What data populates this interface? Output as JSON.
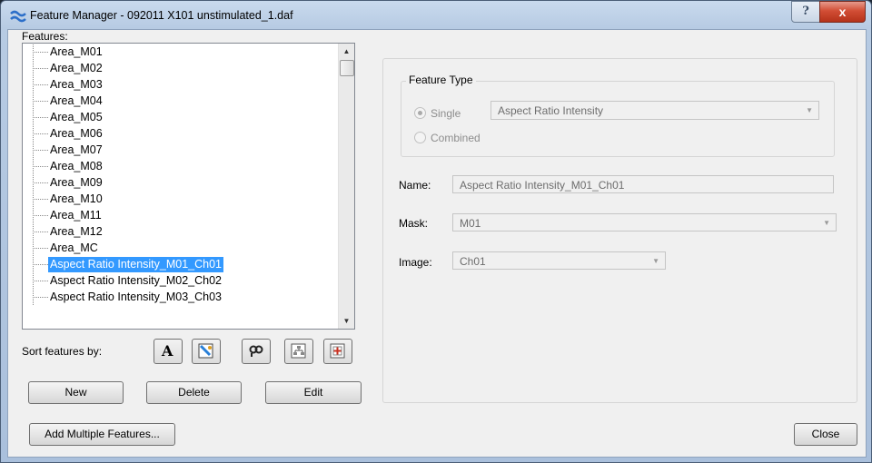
{
  "window": {
    "title": "Feature Manager - 092011 X101 unstimulated_1.daf",
    "help_label": "?",
    "close_label": "x"
  },
  "features_label": "Features:",
  "features": [
    "Area_M01",
    "Area_M02",
    "Area_M03",
    "Area_M04",
    "Area_M05",
    "Area_M06",
    "Area_M07",
    "Area_M08",
    "Area_M09",
    "Area_M10",
    "Area_M11",
    "Area_M12",
    "Area_MC",
    "Aspect Ratio Intensity_M01_Ch01",
    "Aspect Ratio Intensity_M02_Ch02",
    "Aspect Ratio Intensity_M03_Ch03"
  ],
  "selected_index": 13,
  "sort": {
    "label": "Sort features by:",
    "options": [
      "alphabetical-icon",
      "category-icon",
      "link-icon",
      "tree-icon",
      "add-icon"
    ]
  },
  "buttons": {
    "new": "New",
    "delete": "Delete",
    "edit": "Edit",
    "add_multiple": "Add Multiple Features...",
    "close": "Close"
  },
  "feature_type": {
    "title": "Feature Type",
    "single_label": "Single",
    "combined_label": "Combined",
    "selected": "Single",
    "type_value": "Aspect Ratio Intensity"
  },
  "name": {
    "label": "Name:",
    "value": "Aspect Ratio Intensity_M01_Ch01"
  },
  "mask": {
    "label": "Mask:",
    "value": "M01"
  },
  "image": {
    "label": "Image:",
    "value": "Ch01"
  },
  "colors": {
    "selection": "#3399ff",
    "close_button": "#d24e35"
  }
}
